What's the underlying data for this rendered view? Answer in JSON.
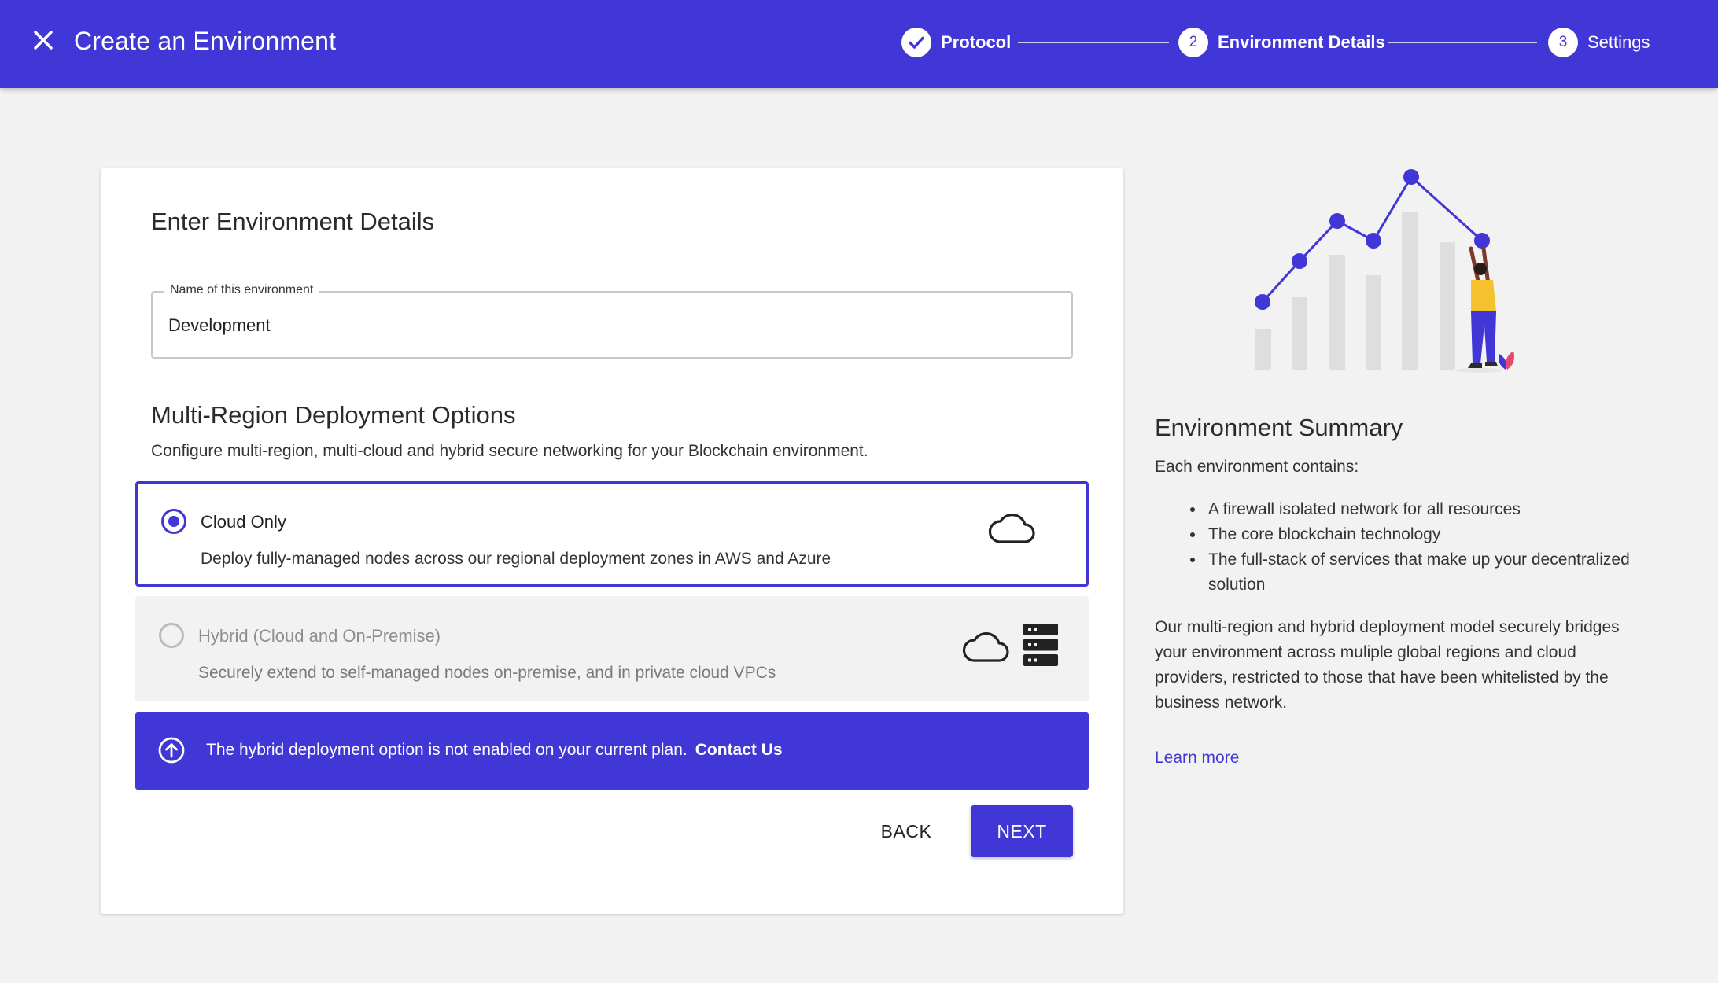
{
  "header": {
    "title": "Create an Environment",
    "steps": [
      {
        "number": "",
        "label": "Protocol",
        "status": "complete"
      },
      {
        "number": "2",
        "label": "Environment Details",
        "status": "active"
      },
      {
        "number": "3",
        "label": "Settings",
        "status": "pending"
      }
    ]
  },
  "form": {
    "title": "Enter Environment Details",
    "name_field": {
      "label": "Name of this environment",
      "value": "Development"
    },
    "deployment": {
      "title": "Multi-Region Deployment Options",
      "description": "Configure multi-region, multi-cloud and hybrid secure networking for your Blockchain environment.",
      "options": [
        {
          "title": "Cloud Only",
          "description": "Deploy fully-managed nodes across our regional deployment zones in AWS and Azure",
          "selected": true,
          "enabled": true,
          "icons": [
            "cloud-icon"
          ]
        },
        {
          "title": "Hybrid (Cloud and On-Premise)",
          "description": "Securely extend to self-managed nodes on-premise, and in private cloud VPCs",
          "selected": false,
          "enabled": false,
          "icons": [
            "cloud-icon",
            "server-icon"
          ]
        }
      ]
    },
    "banner": {
      "text": "The hybrid deployment option is not enabled on your current plan.",
      "link": "Contact Us"
    },
    "buttons": {
      "back": "BACK",
      "next": "NEXT"
    }
  },
  "summary": {
    "title": "Environment Summary",
    "intro": "Each environment contains:",
    "items": [
      "A firewall isolated network for all resources",
      "The core blockchain technology",
      "The full-stack of services that make up your decentralized solution"
    ],
    "body": "Our multi-region and hybrid deployment model securely bridges your environment across muliple global regions and cloud providers, restricted to those that have been whitelisted by the business network.",
    "link": "Learn more"
  },
  "colors": {
    "accent": "#4136d6",
    "background": "#f2f2f2",
    "card": "#ffffff"
  }
}
